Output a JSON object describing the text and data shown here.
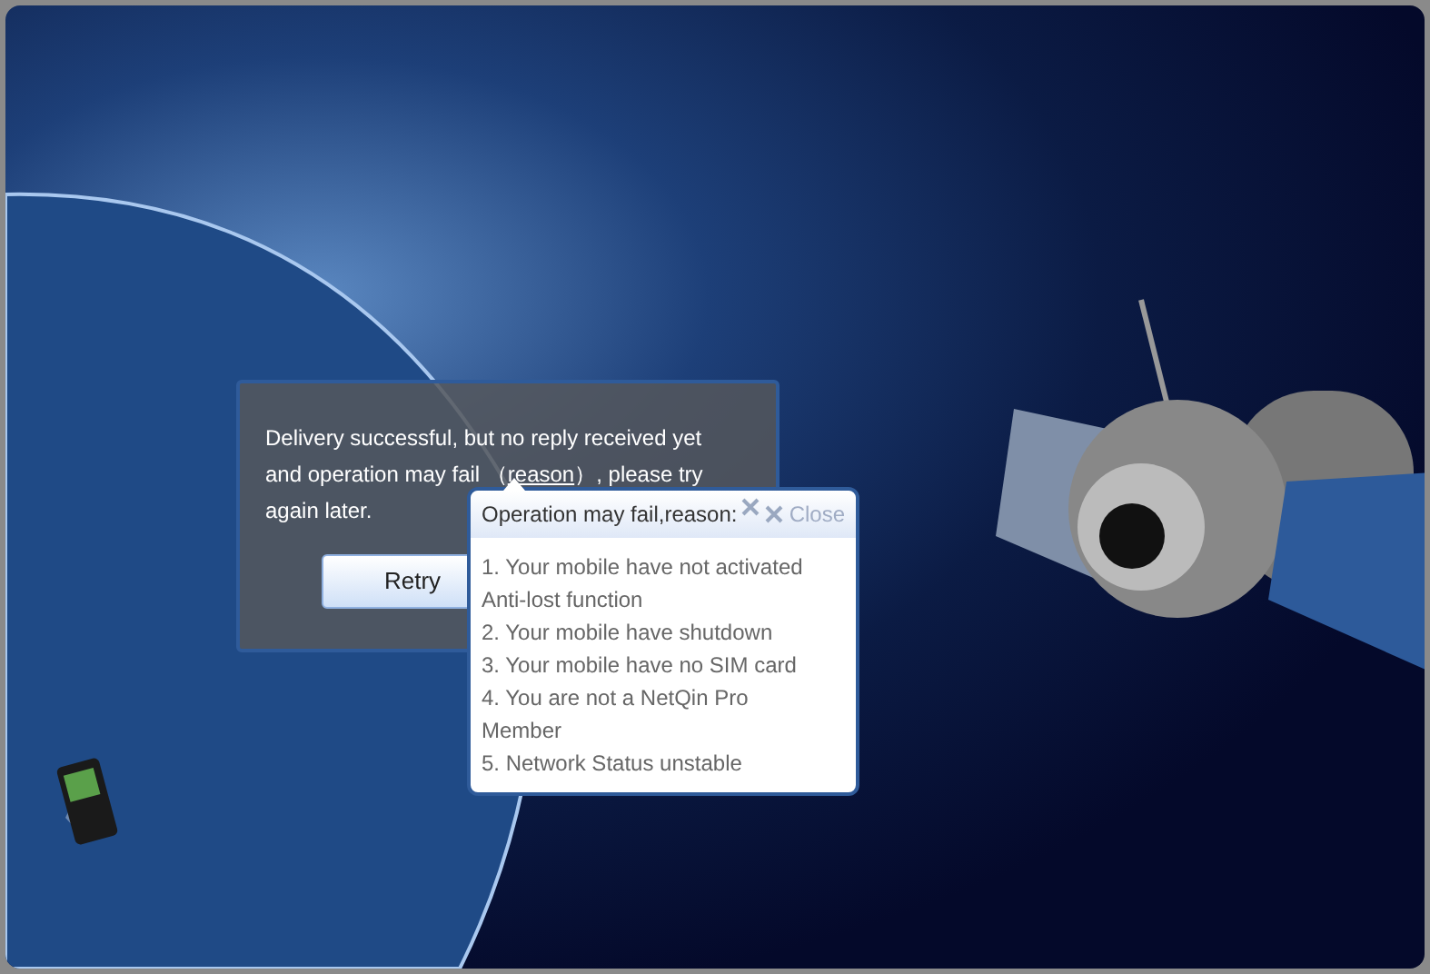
{
  "message": {
    "before": "Delivery successful, but no reply received yet and operation may fail （",
    "link": "reason",
    "after": "）, please try again later."
  },
  "retry_button": "Retry",
  "popup": {
    "title": "Operation may fail,reason:",
    "close": "Close",
    "reasons": [
      "1. Your mobile have not activated Anti-lost function",
      "2. Your mobile have shutdown",
      "3. Your mobile have no SIM card",
      "4. You are not a NetQin Pro Member",
      "5. Network Status unstable"
    ]
  }
}
